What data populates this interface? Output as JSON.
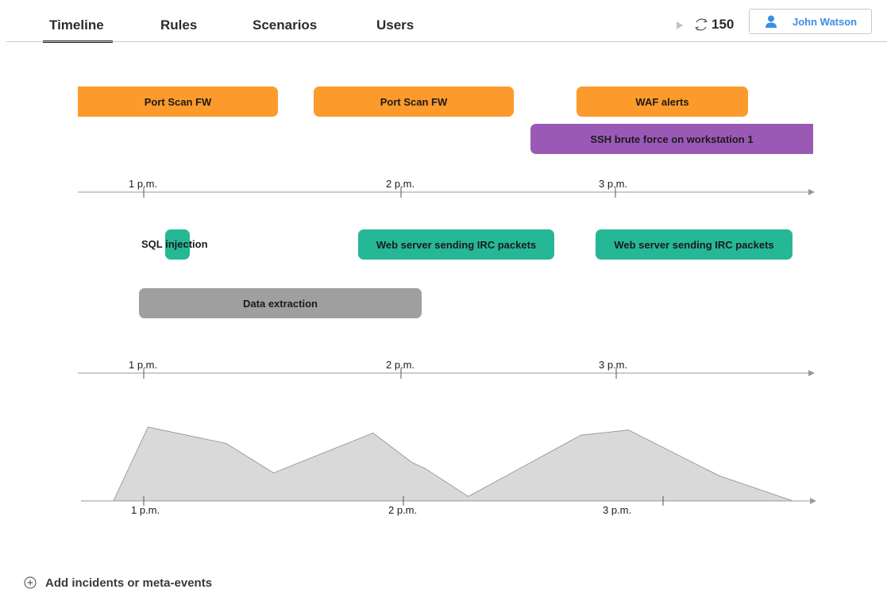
{
  "nav": {
    "tabs": [
      {
        "label": "Timeline",
        "active": true
      },
      {
        "label": "Rules",
        "active": false
      },
      {
        "label": "Scenarios",
        "active": false
      },
      {
        "label": "Users",
        "active": false
      }
    ],
    "counter": "150",
    "user_name": "John Watson",
    "play_icon": "play-icon",
    "refresh_icon": "refresh-icon",
    "user_icon": "user-icon"
  },
  "top_events": {
    "bars": [
      {
        "label": "Port Scan FW",
        "color": "#fd9a2c"
      },
      {
        "label": "Port Scan FW",
        "color": "#fd9a2c"
      },
      {
        "label": "WAF alerts",
        "color": "#fd9a2c"
      },
      {
        "label": "SSH brute force on workstation 1",
        "color": "#9b59b6"
      }
    ]
  },
  "axis1": {
    "ticks": [
      "1 p.m.",
      "2 p.m.",
      "3 p.m."
    ]
  },
  "bottom_events": {
    "sql_label": "SQL injection",
    "bars": [
      {
        "label": "Web server sending IRC packets",
        "color": "#26b896"
      },
      {
        "label": "Web server sending IRC packets",
        "color": "#26b896"
      },
      {
        "label": "Data extraction",
        "color": "#9f9f9f"
      }
    ]
  },
  "axis2": {
    "ticks": [
      "1 p.m.",
      "2 p.m.",
      "3 p.m."
    ]
  },
  "chart_data": {
    "type": "area",
    "x": [
      "12:53",
      "13:01",
      "13:19",
      "13:30",
      "13:53",
      "14:02",
      "14:05",
      "14:15",
      "14:41",
      "14:52",
      "15:13",
      "15:30"
    ],
    "series": [
      {
        "values": [
          0,
          100,
          78,
          38,
          92,
          52,
          44,
          6,
          89,
          96,
          34,
          0
        ]
      }
    ],
    "xticks": [
      "1 p.m.",
      "2 p.m.",
      "3 p.m."
    ],
    "fill": "#d9d9d9",
    "grid": false
  },
  "footer": {
    "add_label": "Add incidents or meta-events",
    "add_icon": "plus-circle-icon"
  }
}
